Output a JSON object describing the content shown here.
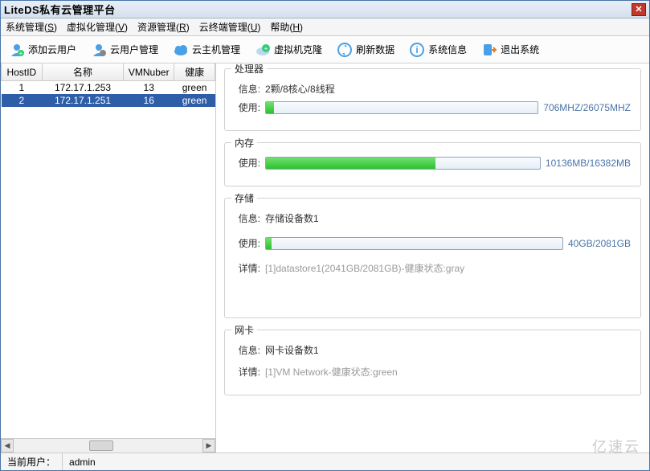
{
  "window": {
    "title": "LiteDS私有云管理平台"
  },
  "menubar": [
    {
      "label": "系统管理",
      "key": "S"
    },
    {
      "label": "虚拟化管理",
      "key": "V"
    },
    {
      "label": "资源管理",
      "key": "R"
    },
    {
      "label": "云终端管理",
      "key": "U"
    },
    {
      "label": "帮助",
      "key": "H"
    }
  ],
  "toolbar": [
    {
      "label": "添加云用户",
      "icon": "user-plus-blue"
    },
    {
      "label": "云用户管理",
      "icon": "user-gear-blue"
    },
    {
      "label": "云主机管理",
      "icon": "cloud-blue"
    },
    {
      "label": "虚拟机克隆",
      "icon": "clone-green"
    },
    {
      "label": "刷新数据",
      "icon": "refresh-blue"
    },
    {
      "label": "系统信息",
      "icon": "info-blue"
    },
    {
      "label": "退出系统",
      "icon": "exit-blue"
    }
  ],
  "hosts": {
    "columns": [
      "HostID",
      "名称",
      "VMNuber",
      "健康"
    ],
    "rows": [
      {
        "hostid": "1",
        "name": "172.17.1.253",
        "vmnum": "13",
        "health": "green",
        "selected": false
      },
      {
        "hostid": "2",
        "name": "172.17.1.251",
        "vmnum": "16",
        "health": "green",
        "selected": true
      }
    ]
  },
  "panels": {
    "cpu": {
      "title": "处理器",
      "info_label": "信息:",
      "info_value": "2颗/8核心/8线程",
      "usage_label": "使用:",
      "usage_percent": 3,
      "usage_text": "706MHZ/26075MHZ"
    },
    "memory": {
      "title": "内存",
      "usage_label": "使用:",
      "usage_percent": 62,
      "usage_text": "10136MB/16382MB"
    },
    "storage": {
      "title": "存储",
      "info_label": "信息:",
      "info_value": "存储设备数1",
      "usage_label": "使用:",
      "usage_percent": 2,
      "usage_text": "40GB/2081GB",
      "detail_label": "详情:",
      "detail_value": "[1]datastore1(2041GB/2081GB)-健康状态:gray"
    },
    "nic": {
      "title": "网卡",
      "info_label": "信息:",
      "info_value": "网卡设备数1",
      "detail_label": "详情:",
      "detail_value": "[1]VM Network-健康状态:green"
    }
  },
  "statusbar": {
    "label": "当前用户：",
    "user": "admin"
  },
  "watermark": "亿速云"
}
